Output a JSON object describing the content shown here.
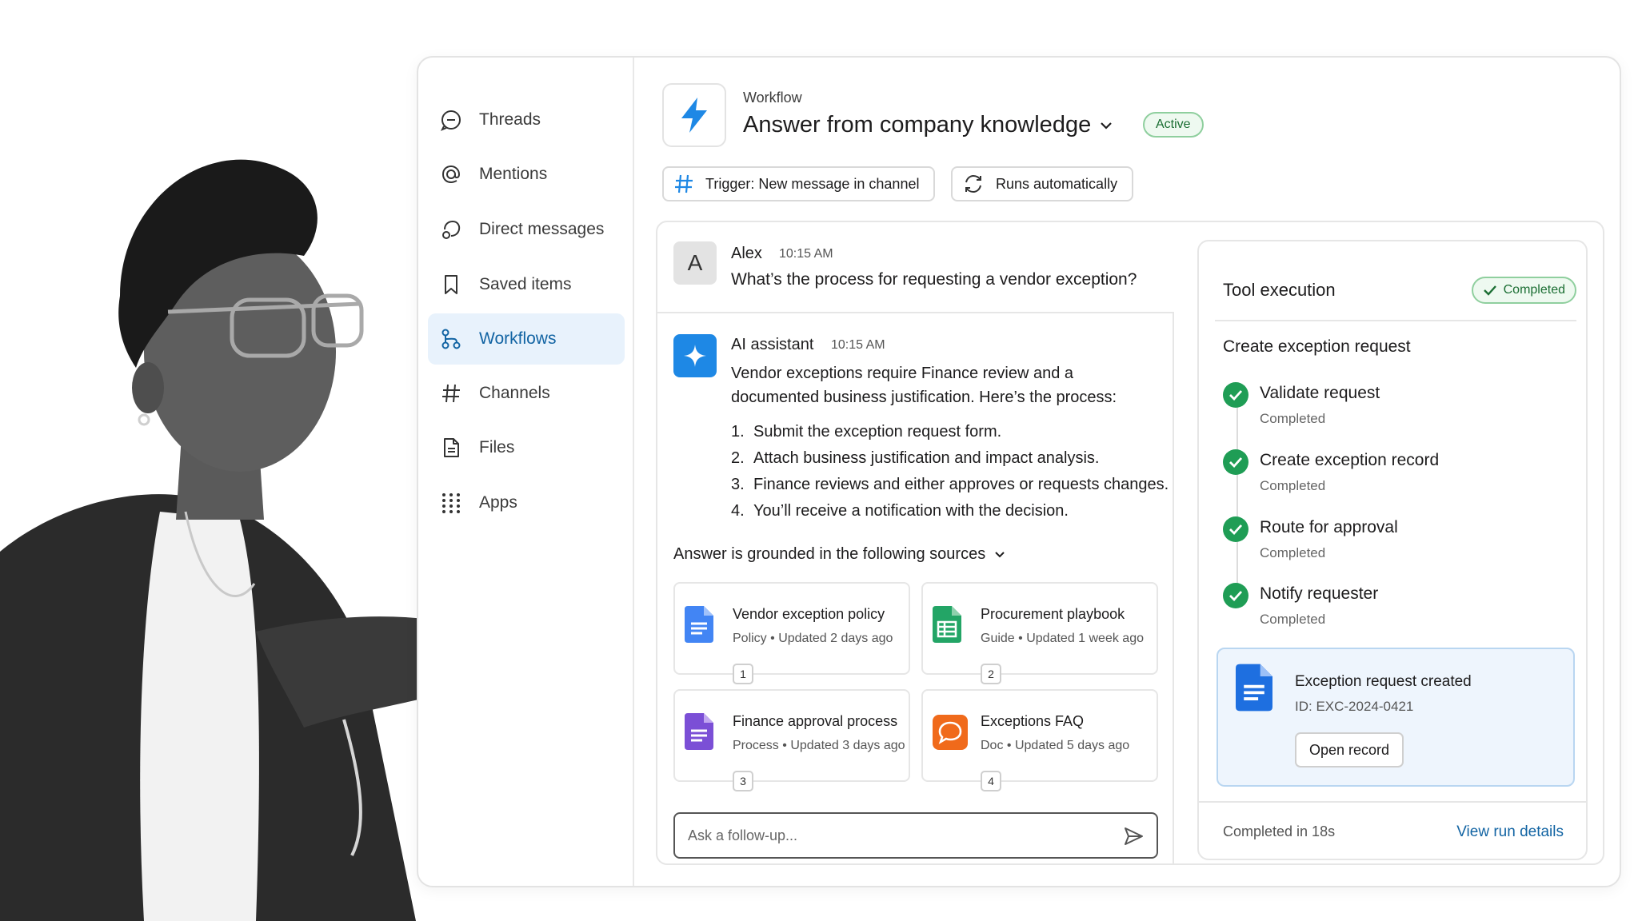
{
  "sidebar": {
    "items": [
      {
        "label": "Threads",
        "icon": "threads-icon"
      },
      {
        "label": "Mentions",
        "icon": "at-icon"
      },
      {
        "label": "Direct messages",
        "icon": "direct-messages-icon"
      },
      {
        "label": "Saved items",
        "icon": "bookmark-icon"
      },
      {
        "label": "Workflows",
        "icon": "workflow-icon",
        "active": true
      },
      {
        "label": "Channels",
        "icon": "hash-icon"
      },
      {
        "label": "Files",
        "icon": "file-icon"
      },
      {
        "label": "Apps",
        "icon": "apps-grid-icon"
      }
    ]
  },
  "header": {
    "kicker": "Workflow",
    "title": "Answer from company knowledge",
    "status": "Active",
    "trigger_chip": "Trigger: New message in channel",
    "runs_chip": "Runs automatically"
  },
  "conversation": {
    "user_message": {
      "avatar_letter": "A",
      "sender": "Alex",
      "time": "10:15 AM",
      "text": "What’s the process for requesting a vendor exception?"
    },
    "ai_message": {
      "sender": "AI assistant",
      "time": "10:15 AM",
      "intro": "Vendor exceptions require Finance review and a documented business justification. Here’s the process:",
      "steps": [
        {
          "num": "1.",
          "text": "Submit the exception request form."
        },
        {
          "num": "2.",
          "text": "Attach business justification and impact analysis."
        },
        {
          "num": "3.",
          "text": "Finance reviews and either approves or requests changes."
        },
        {
          "num": "4.",
          "text": "You’ll receive a notification with the decision."
        }
      ],
      "sources_heading": "Answer is grounded in the following sources",
      "sources": [
        {
          "title": "Vendor exception policy",
          "type": "Policy",
          "updated": "Updated 2 days ago",
          "num": "1",
          "icon": "google-docs-icon",
          "color": "#4285f4"
        },
        {
          "title": "Procurement playbook",
          "type": "Guide",
          "updated": "Updated 1 week ago",
          "num": "2",
          "icon": "google-sheets-icon",
          "color": "#23a566"
        },
        {
          "title": "Finance approval process",
          "type": "Process",
          "updated": "Updated 3 days ago",
          "num": "3",
          "icon": "google-forms-icon",
          "color": "#7b4fd6"
        },
        {
          "title": "Exceptions FAQ",
          "type": "Doc",
          "updated": "Updated 5 days ago",
          "num": "4",
          "icon": "chat-doc-icon",
          "color": "#f06a1b"
        }
      ],
      "meta_separator": "•"
    },
    "followup_placeholder": "Ask a follow-up..."
  },
  "tool_execution": {
    "title": "Tool execution",
    "status": "Completed",
    "subtitle": "Create exception request",
    "steps": [
      {
        "name": "Validate request",
        "status": "Completed"
      },
      {
        "name": "Create exception record",
        "status": "Completed"
      },
      {
        "name": "Route for approval",
        "status": "Completed"
      },
      {
        "name": "Notify requester",
        "status": "Completed"
      }
    ],
    "result": {
      "title": "Exception request created",
      "id": "ID: EXC-2024-0421",
      "button": "Open record"
    },
    "footer_left": "Completed in 18s",
    "footer_link": "View run details"
  },
  "colors": {
    "accent": "#1264a3",
    "active_bg": "#e8f2fc",
    "success": "#1f9d55",
    "ai_blue": "#1e88e5"
  }
}
